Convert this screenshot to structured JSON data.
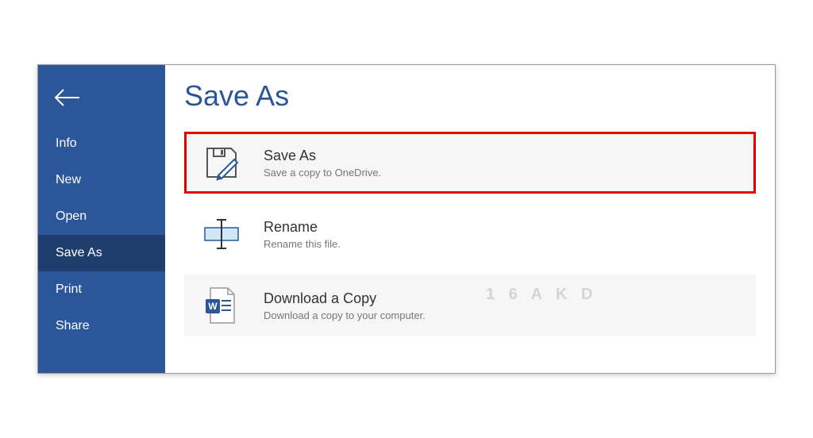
{
  "sidebar": {
    "items": [
      {
        "label": "Info"
      },
      {
        "label": "New"
      },
      {
        "label": "Open"
      },
      {
        "label": "Save As"
      },
      {
        "label": "Print"
      },
      {
        "label": "Share"
      }
    ],
    "selectedIndex": 3
  },
  "page": {
    "title": "Save As"
  },
  "options": {
    "saveAs": {
      "title": "Save As",
      "subtitle": "Save a copy to OneDrive."
    },
    "rename": {
      "title": "Rename",
      "subtitle": "Rename this file."
    },
    "download": {
      "title": "Download a Copy",
      "subtitle": "Download a copy to your computer."
    }
  },
  "watermark": {
    "large": "1 6 A K D",
    "small": ""
  },
  "colors": {
    "brand": "#2b579a",
    "highlightBorder": "#e60000"
  }
}
